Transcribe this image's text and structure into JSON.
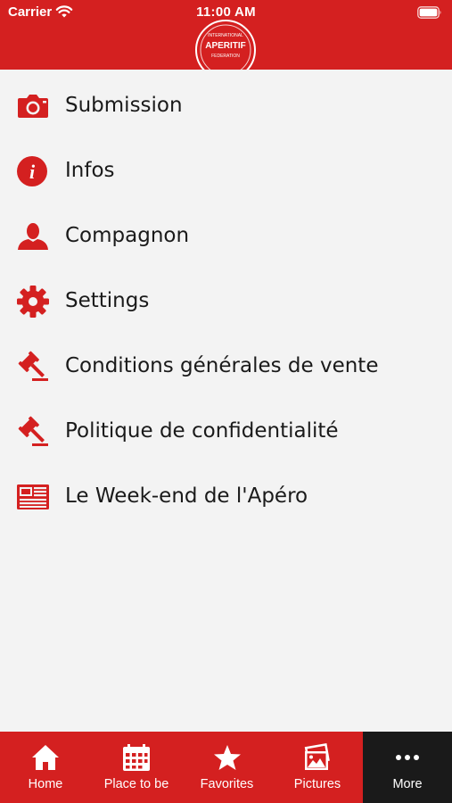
{
  "status_bar": {
    "carrier": "Carrier",
    "time": "11:00 AM"
  },
  "header": {
    "logo": {
      "line1": "INTERNATIONAL",
      "line2": "APERITIF",
      "line3": "FEDERATION"
    },
    "color": "#d42020"
  },
  "menu": {
    "items": [
      {
        "label": "Submission",
        "icon": "camera-icon"
      },
      {
        "label": "Infos",
        "icon": "info-icon"
      },
      {
        "label": "Compagnon",
        "icon": "person-icon"
      },
      {
        "label": "Settings",
        "icon": "gear-icon"
      },
      {
        "label": "Conditions générales de vente",
        "icon": "gavel-icon"
      },
      {
        "label": "Politique de confidentialité",
        "icon": "gavel-icon"
      },
      {
        "label": "Le Week-end de l'Apéro",
        "icon": "newspaper-icon"
      }
    ]
  },
  "tabbar": {
    "tabs": [
      {
        "label": "Home",
        "icon": "home-icon"
      },
      {
        "label": "Place to be",
        "icon": "calendar-icon"
      },
      {
        "label": "Favorites",
        "icon": "star-icon"
      },
      {
        "label": "Pictures",
        "icon": "pictures-icon"
      },
      {
        "label": "More",
        "icon": "more-icon",
        "active": true
      }
    ],
    "active_color": "#1a1a1a"
  }
}
